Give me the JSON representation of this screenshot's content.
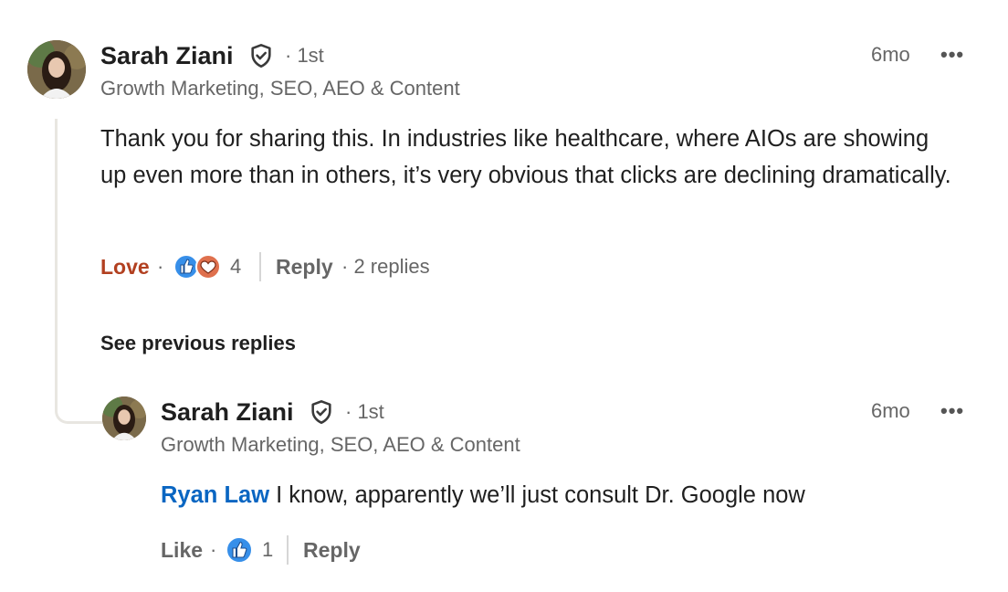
{
  "comment": {
    "author": "Sarah Ziani",
    "degree": "· 1st",
    "headline": "Growth Marketing, SEO, AEO & Content",
    "time": "6mo",
    "more": "•••",
    "text": "Thank you for sharing this. In industries like healthcare, where AIOs are showing up even more than in others, it’s very obvious that clicks are declining dramatically.",
    "reaction_label": "Love",
    "reaction_count": "4",
    "reply_label": "Reply",
    "replies_count": "· 2 replies"
  },
  "see_previous": "See previous replies",
  "reply": {
    "author": "Sarah Ziani",
    "degree": "· 1st",
    "headline": "Growth Marketing, SEO, AEO & Content",
    "time": "6mo",
    "more": "•••",
    "mention": "Ryan Law",
    "text": " I know, apparently we’ll just consult Dr. Google now",
    "reaction_label": "Like",
    "reaction_count": "1",
    "reply_label": "Reply"
  },
  "colors": {
    "love": "#b24020",
    "mention": "#0a66c2",
    "like_icon": "#378fe9",
    "love_icon": "#df704d"
  }
}
